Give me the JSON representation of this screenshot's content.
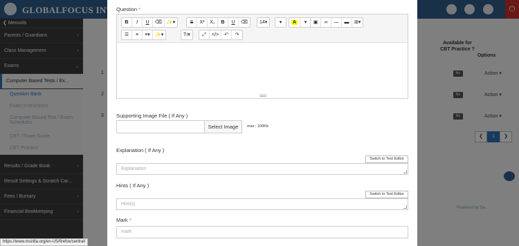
{
  "app": {
    "brand": "GLOBALFOCUS INT'L SC"
  },
  "sidebar": {
    "toggle_label": "Menu",
    "toggle_suffix": "ols",
    "items": [
      {
        "label": "Parents / Guardians"
      },
      {
        "label": "Class Management"
      },
      {
        "label": "Exams"
      },
      {
        "label": "Computer Based Tests / Ex..."
      }
    ],
    "subitems": [
      {
        "label": "Question Bank"
      },
      {
        "label": "Exam Instructions"
      },
      {
        "label": "Computer Based Test / Exam Schedules"
      },
      {
        "label": "CBT / Exam Score"
      },
      {
        "label": "CBT Practice"
      }
    ],
    "bottom_items": [
      {
        "label": "Results / Grade Book"
      },
      {
        "label": "Result Settings & Scratch Car..."
      },
      {
        "label": "Fees / Bursary"
      },
      {
        "label": "Financial Bookkeeping"
      }
    ]
  },
  "table": {
    "cbt_header": "Available for CBT Practice ?",
    "options_header": "Options",
    "rows": [
      {
        "num": "1",
        "cbt": "No",
        "action": "Action ▾"
      },
      {
        "num": "2",
        "cbt": "No",
        "action": "Action ▾"
      },
      {
        "num": "3",
        "cbt": "No",
        "action": "Action ▾"
      }
    ],
    "pager_prev": "❮",
    "pager_current": "1",
    "pager_next": "❯"
  },
  "modal": {
    "question_label": "Question",
    "required_mark": "*",
    "toolbar": {
      "bold": "B",
      "italic": "I",
      "underline": "U",
      "eraser": "⌫",
      "magic": "✨▾",
      "strike": "S",
      "superscript": "X²",
      "subscript": "X₂",
      "bold2": "B",
      "underline2": "U",
      "eraser2": "⌫",
      "font_size": "14▾",
      "dropdown": "▾",
      "font_color": "A",
      "color_caret": "▾",
      "image": "▣",
      "link": "∞",
      "hr": "—",
      "video": "▬",
      "table": "⊞▾",
      "ul": "☰",
      "ol": "≡",
      "align": "≡▾",
      "style": "✨▾",
      "text_style": "Tı▾",
      "fullscreen": "⤢",
      "code": "</>",
      "undo": "↶",
      "redo": "↷"
    },
    "image_label": "Supporting Image File ( If Any )",
    "select_image": "Select Image",
    "max_note": "max.: 100Kb",
    "explanation_label": "Explanation ( If Any )",
    "explanation_switch": "Switch to Text Editor",
    "explanation_placeholder": "Explanation",
    "hints_label": "Hints ( If Any )",
    "hints_switch": "Switch to Text Editor",
    "hints_placeholder": "Hint(s)",
    "mark_label": "Mark",
    "mark_placeholder": "mark"
  },
  "status_bar": {
    "url": "https://www.mozilla.org/en-US/firefox/central/"
  },
  "colors": {
    "topbar": "#2f5d8a",
    "sidebar": "#3a3a3a",
    "required": "#d9534f",
    "accent": "#2f6fb3"
  }
}
